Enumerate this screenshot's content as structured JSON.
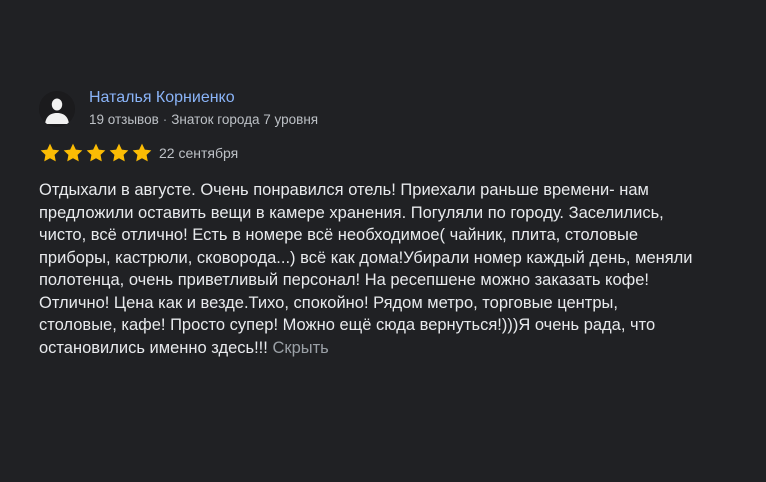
{
  "review": {
    "author": "Наталья Корниенко",
    "reviews_count": "19 отзывов",
    "separator": "·",
    "badge": "Знаток города 7 уровня",
    "rating": 5,
    "rating_max": 5,
    "date": "22 сентября",
    "text": "Отдыхали в августе. Очень понравился отель! Приехали раньше времени- нам предложили оставить вещи в камере хранения. Погуляли по городу. Заселились, чисто, всё отлично! Есть в номере всё необходимое( чайник, плита, столовые приборы, кастрюли, сковорода...) всё как дома!Убирали номер каждый день, меняли полотенца, очень приветливый персонал! На ресепшене можно заказать кофе! Отлично! Цена как и везде.Тихо, спокойно! Рядом метро, торговые центры, столовые, кафе! Просто супер! Можно ещё сюда вернуться!)))Я очень рада, что остановились именно здесь!!!",
    "hide_label": "Скрыть"
  },
  "colors": {
    "background": "#202124",
    "author_link": "#8ab4f8",
    "star": "#fbbc04",
    "text": "#e8eaed",
    "muted": "#bdc1c6"
  },
  "icons": {
    "avatar": "user-silhouette-icon",
    "star": "star-icon"
  }
}
